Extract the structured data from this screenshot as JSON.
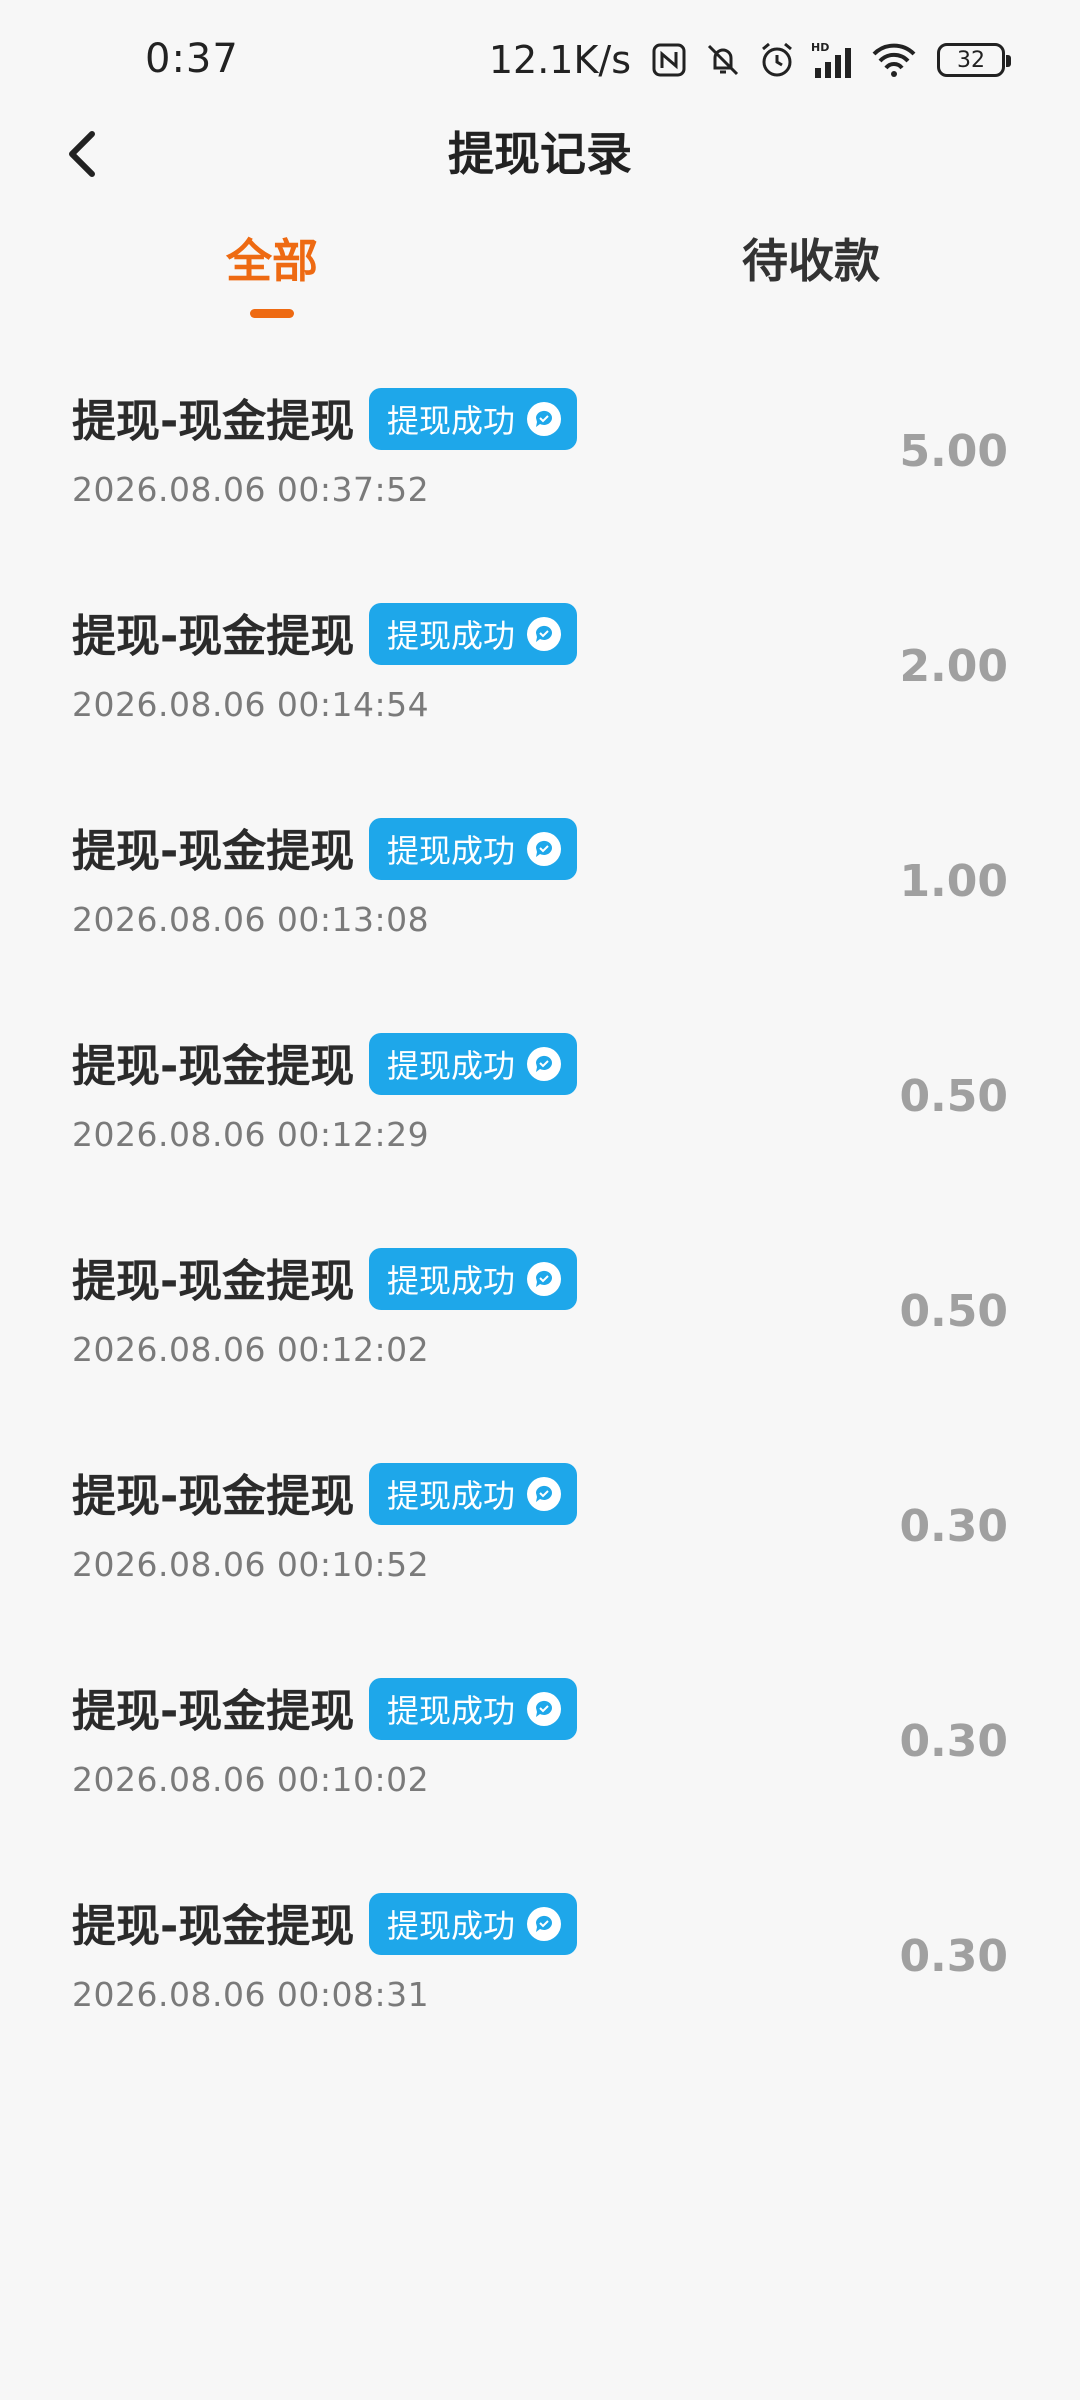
{
  "status_bar": {
    "time": "0:37",
    "net_speed": "12.1K/s",
    "battery": "32",
    "icons": [
      "nfc-icon",
      "bell-muted-icon",
      "alarm-icon",
      "hd-signal-icon",
      "wifi-icon",
      "battery-icon"
    ]
  },
  "header": {
    "title": "提现记录",
    "back_icon": "chevron-left-icon"
  },
  "tabs": [
    {
      "label": "全部",
      "active": true
    },
    {
      "label": "待收款",
      "active": false
    }
  ],
  "colors": {
    "accent": "#ee6a12",
    "badge": "#1ea7ea",
    "amount": "#a0a0a0"
  },
  "records": [
    {
      "title": "提现-现金提现",
      "status": "提现成功",
      "time": "2026.08.06 00:37:52",
      "amount": "5.00"
    },
    {
      "title": "提现-现金提现",
      "status": "提现成功",
      "time": "2026.08.06 00:14:54",
      "amount": "2.00"
    },
    {
      "title": "提现-现金提现",
      "status": "提现成功",
      "time": "2026.08.06 00:13:08",
      "amount": "1.00"
    },
    {
      "title": "提现-现金提现",
      "status": "提现成功",
      "time": "2026.08.06 00:12:29",
      "amount": "0.50"
    },
    {
      "title": "提现-现金提现",
      "status": "提现成功",
      "time": "2026.08.06 00:12:02",
      "amount": "0.50"
    },
    {
      "title": "提现-现金提现",
      "status": "提现成功",
      "time": "2026.08.06 00:10:52",
      "amount": "0.30"
    },
    {
      "title": "提现-现金提现",
      "status": "提现成功",
      "time": "2026.08.06 00:10:02",
      "amount": "0.30"
    },
    {
      "title": "提现-现金提现",
      "status": "提现成功",
      "time": "2026.08.06 00:08:31",
      "amount": "0.30"
    }
  ]
}
